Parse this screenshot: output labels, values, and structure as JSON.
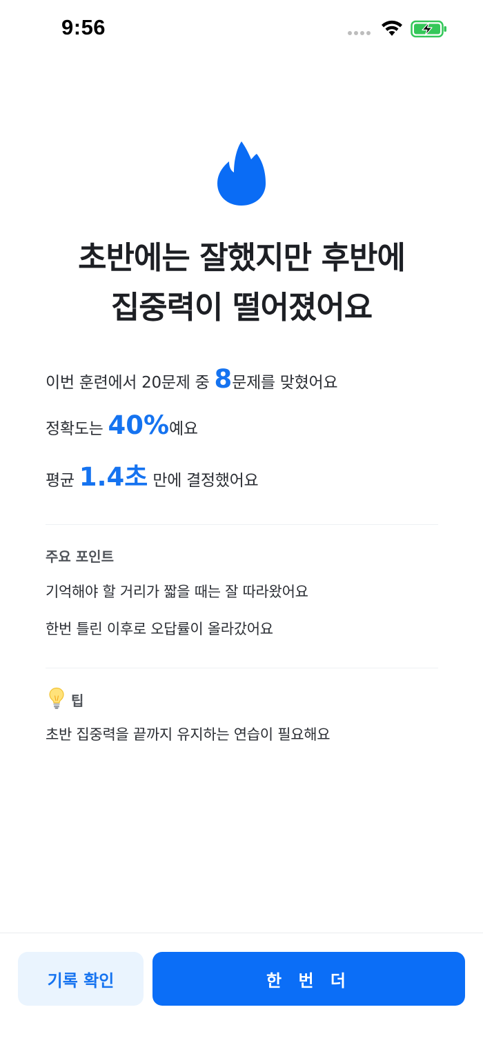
{
  "status_bar": {
    "time": "9:56",
    "wifi_icon": "wifi-icon",
    "battery_icon": "battery-charging-icon",
    "battery_color": "#34c759"
  },
  "hero": {
    "icon": "fire-icon",
    "icon_color": "#0a6cf5",
    "headline_line1": "초반에는 잘했지만 후반에",
    "headline_line2": "집중력이 떨어졌어요"
  },
  "stats": {
    "line1_prefix": "이번 훈련에서 20문제 중 ",
    "correct_count": "8",
    "line1_suffix": "문제를 맞혔어요",
    "line2_prefix": "정확도는 ",
    "accuracy": "40%",
    "line2_suffix": "예요",
    "line3_prefix": "평균 ",
    "avg_time": "1.4초",
    "line3_suffix": " 만에 결정했어요",
    "highlight_color": "#1573f0"
  },
  "key_points": {
    "title": "주요 포인트",
    "items": [
      "기억해야 할 거리가 짧을 때는 잘 따라왔어요",
      "한번 틀린 이후로 오답률이 올라갔어요"
    ]
  },
  "tip": {
    "icon": "lightbulb-icon",
    "title": "팁",
    "text": "초반 집중력을 끝까지 유지하는 연습이 필요해요"
  },
  "buttons": {
    "history_label": "기록 확인",
    "retry_label": "한 번 더",
    "primary_color": "#0b6ef7",
    "secondary_bg": "#eaf4fe"
  }
}
